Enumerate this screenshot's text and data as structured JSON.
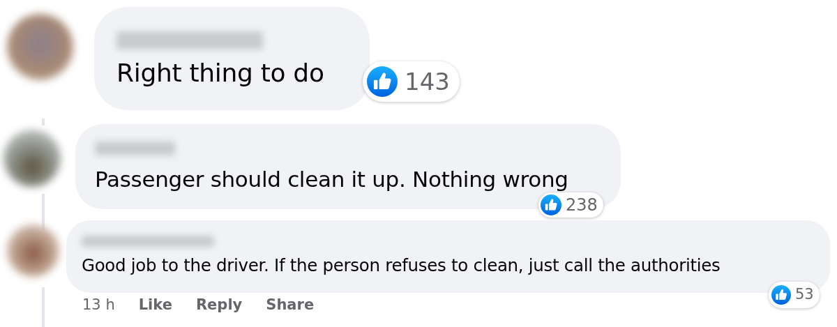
{
  "comments": [
    {
      "text": "Right thing to do",
      "reactions": "143"
    },
    {
      "text": "Passenger should clean it up. Nothing wrong",
      "reactions": "238"
    },
    {
      "text": "Good job to the driver. If the person refuses to clean, just call the authorities",
      "reactions": "53",
      "time": "13 h",
      "actions": [
        "Like",
        "Reply",
        "Share"
      ]
    }
  ]
}
